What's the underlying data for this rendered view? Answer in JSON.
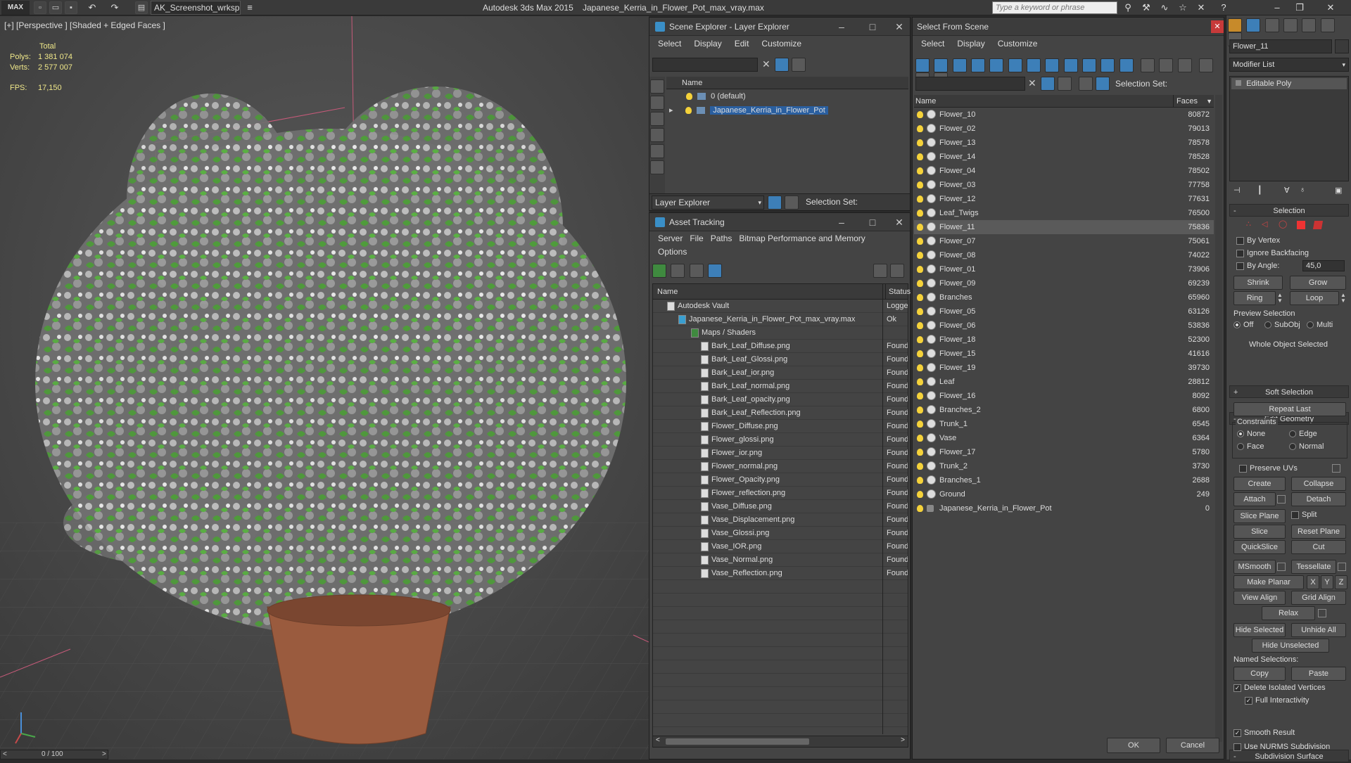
{
  "titlebar": {
    "app_logo": "MAX",
    "workspace": "AK_Screenshot_wrksp",
    "app_title": "Autodesk 3ds Max  2015",
    "file_title": "Japanese_Kerria_in_Flower_Pot_max_vray.max",
    "search_placeholder": "Type a keyword or phrase"
  },
  "viewport": {
    "label": "[+] [Perspective ] [Shaded + Edged Faces ]",
    "stats_total": "Total",
    "polys_label": "Polys:",
    "polys_value": "1 381 074",
    "verts_label": "Verts:",
    "verts_value": "2 577 007",
    "fps_label": "FPS:",
    "fps_value": "17,150",
    "timeline": "0 / 100"
  },
  "scene_explorer": {
    "title": "Scene Explorer - Layer Explorer",
    "menu": [
      "Select",
      "Display",
      "Edit",
      "Customize"
    ],
    "col_name": "Name",
    "layers": [
      {
        "name": "0 (default)"
      },
      {
        "name": "Japanese_Kerria_in_Flower_Pot"
      }
    ],
    "footer_mode": "Layer Explorer",
    "selection_set_label": "Selection Set:"
  },
  "asset_tracking": {
    "title": "Asset Tracking",
    "menu": [
      "Server",
      "File",
      "Paths",
      "Bitmap Performance and Memory"
    ],
    "menu2": "Options",
    "col_name": "Name",
    "col_status": "Status",
    "rows": [
      {
        "name": "Autodesk Vault",
        "status": "Logge"
      },
      {
        "name": "Japanese_Kerria_in_Flower_Pot_max_vray.max",
        "status": "Ok"
      },
      {
        "name": "Maps / Shaders",
        "status": ""
      },
      {
        "name": "Bark_Leaf_Diffuse.png",
        "status": "Found"
      },
      {
        "name": "Bark_Leaf_Glossi.png",
        "status": "Found"
      },
      {
        "name": "Bark_Leaf_ior.png",
        "status": "Found"
      },
      {
        "name": "Bark_Leaf_normal.png",
        "status": "Found"
      },
      {
        "name": "Bark_Leaf_opacity.png",
        "status": "Found"
      },
      {
        "name": "Bark_Leaf_Reflection.png",
        "status": "Found"
      },
      {
        "name": "Flower_Diffuse.png",
        "status": "Found"
      },
      {
        "name": "Flower_glossi.png",
        "status": "Found"
      },
      {
        "name": "Flower_ior.png",
        "status": "Found"
      },
      {
        "name": "Flower_normal.png",
        "status": "Found"
      },
      {
        "name": "Flower_Opacity.png",
        "status": "Found"
      },
      {
        "name": "Flower_reflection.png",
        "status": "Found"
      },
      {
        "name": "Vase_Diffuse.png",
        "status": "Found"
      },
      {
        "name": "Vase_Displacement.png",
        "status": "Found"
      },
      {
        "name": "Vase_Glossi.png",
        "status": "Found"
      },
      {
        "name": "Vase_IOR.png",
        "status": "Found"
      },
      {
        "name": "Vase_Normal.png",
        "status": "Found"
      },
      {
        "name": "Vase_Reflection.png",
        "status": "Found"
      }
    ]
  },
  "select_from_scene": {
    "title": "Select From Scene",
    "menu": [
      "Select",
      "Display",
      "Customize"
    ],
    "selection_set_label": "Selection Set:",
    "col_name": "Name",
    "col_faces": "Faces",
    "rows": [
      {
        "name": "Flower_10",
        "faces": "80872"
      },
      {
        "name": "Flower_02",
        "faces": "79013"
      },
      {
        "name": "Flower_13",
        "faces": "78578"
      },
      {
        "name": "Flower_14",
        "faces": "78528"
      },
      {
        "name": "Flower_04",
        "faces": "78502"
      },
      {
        "name": "Flower_03",
        "faces": "77758"
      },
      {
        "name": "Flower_12",
        "faces": "77631"
      },
      {
        "name": "Leaf_Twigs",
        "faces": "76500"
      },
      {
        "name": "Flower_11",
        "faces": "75836"
      },
      {
        "name": "Flower_07",
        "faces": "75061"
      },
      {
        "name": "Flower_08",
        "faces": "74022"
      },
      {
        "name": "Flower_01",
        "faces": "73906"
      },
      {
        "name": "Flower_09",
        "faces": "69239"
      },
      {
        "name": "Branches",
        "faces": "65960"
      },
      {
        "name": "Flower_05",
        "faces": "63126"
      },
      {
        "name": "Flower_06",
        "faces": "53836"
      },
      {
        "name": "Flower_18",
        "faces": "52300"
      },
      {
        "name": "Flower_15",
        "faces": "41616"
      },
      {
        "name": "Flower_19",
        "faces": "39730"
      },
      {
        "name": "Leaf",
        "faces": "28812"
      },
      {
        "name": "Flower_16",
        "faces": "8092"
      },
      {
        "name": "Branches_2",
        "faces": "6800"
      },
      {
        "name": "Trunk_1",
        "faces": "6545"
      },
      {
        "name": "Vase",
        "faces": "6364"
      },
      {
        "name": "Flower_17",
        "faces": "5780"
      },
      {
        "name": "Trunk_2",
        "faces": "3730"
      },
      {
        "name": "Branches_1",
        "faces": "2688"
      },
      {
        "name": "Ground",
        "faces": "249"
      },
      {
        "name": "Japanese_Kerria_in_Flower_Pot",
        "faces": "0"
      }
    ],
    "ok_label": "OK",
    "cancel_label": "Cancel"
  },
  "command_panel": {
    "object_name": "Flower_11",
    "modifier_list": "Modifier List",
    "stack_item": "Editable Poly",
    "selection_title": "Selection",
    "by_vertex": "By Vertex",
    "ignore_backfacing": "Ignore Backfacing",
    "by_angle": "By Angle:",
    "angle_value": "45,0",
    "shrink": "Shrink",
    "grow": "Grow",
    "ring": "Ring",
    "loop": "Loop",
    "preview_selection": "Preview Selection",
    "off": "Off",
    "subobj": "SubObj",
    "multi": "Multi",
    "whole_object": "Whole Object Selected",
    "soft_selection": "Soft Selection",
    "edit_geometry": "Edit Geometry",
    "repeat_last": "Repeat Last",
    "constraints": "Constraints",
    "none": "None",
    "edge": "Edge",
    "face": "Face",
    "normal": "Normal",
    "preserve_uvs": "Preserve UVs",
    "create": "Create",
    "collapse": "Collapse",
    "attach": "Attach",
    "detach": "Detach",
    "slice_plane": "Slice Plane",
    "split": "Split",
    "slice": "Slice",
    "reset_plane": "Reset Plane",
    "quickslice": "QuickSlice",
    "cut": "Cut",
    "msmooth": "MSmooth",
    "tessellate": "Tessellate",
    "make_planar": "Make Planar",
    "x": "X",
    "y": "Y",
    "z": "Z",
    "view_align": "View Align",
    "grid_align": "Grid Align",
    "relax": "Relax",
    "hide_selected": "Hide Selected",
    "unhide_all": "Unhide All",
    "hide_unselected": "Hide Unselected",
    "named_selections": "Named Selections:",
    "copy": "Copy",
    "paste": "Paste",
    "delete_isolated": "Delete Isolated Vertices",
    "full_interactivity": "Full Interactivity",
    "subdivision_surface": "Subdivision Surface",
    "smooth_result": "Smooth Result",
    "use_nurms": "Use NURMS Subdivision"
  }
}
